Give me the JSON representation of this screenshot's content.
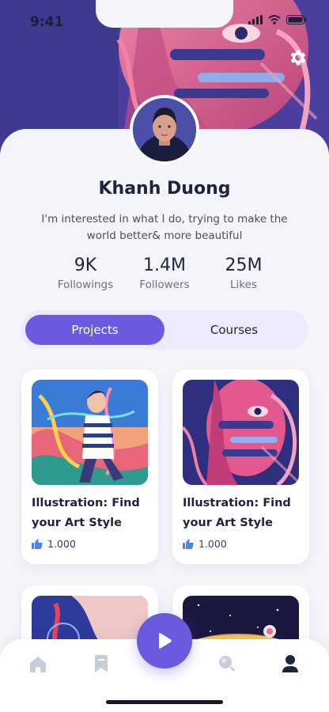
{
  "status_bar": {
    "time": "9:41"
  },
  "profile": {
    "name": "Khanh Duong",
    "bio": "I'm interested in what I do, trying to make the world better& more beautiful"
  },
  "stats": [
    {
      "value": "9K",
      "label": "Followings"
    },
    {
      "value": "1.4M",
      "label": "Followers"
    },
    {
      "value": "25M",
      "label": "Likes"
    }
  ],
  "tabs": [
    {
      "label": "Projects",
      "active": true
    },
    {
      "label": "Courses",
      "active": false
    }
  ],
  "cards": [
    {
      "title": "Illustration: Find your Art Style",
      "likes": "1.000"
    },
    {
      "title": "Illustration: Find your Art Style",
      "likes": "1.000"
    }
  ],
  "bottom_nav": {
    "items": [
      "home-icon",
      "bookmark-icon",
      "play-icon",
      "search-icon",
      "profile-icon"
    ],
    "active": "profile-icon"
  },
  "colors": {
    "accent": "#6a5ae0",
    "tab_track": "#ecebfd",
    "background": "#f4f5fa",
    "text_dark": "#1f2340",
    "like_blue": "#4a84e8"
  }
}
